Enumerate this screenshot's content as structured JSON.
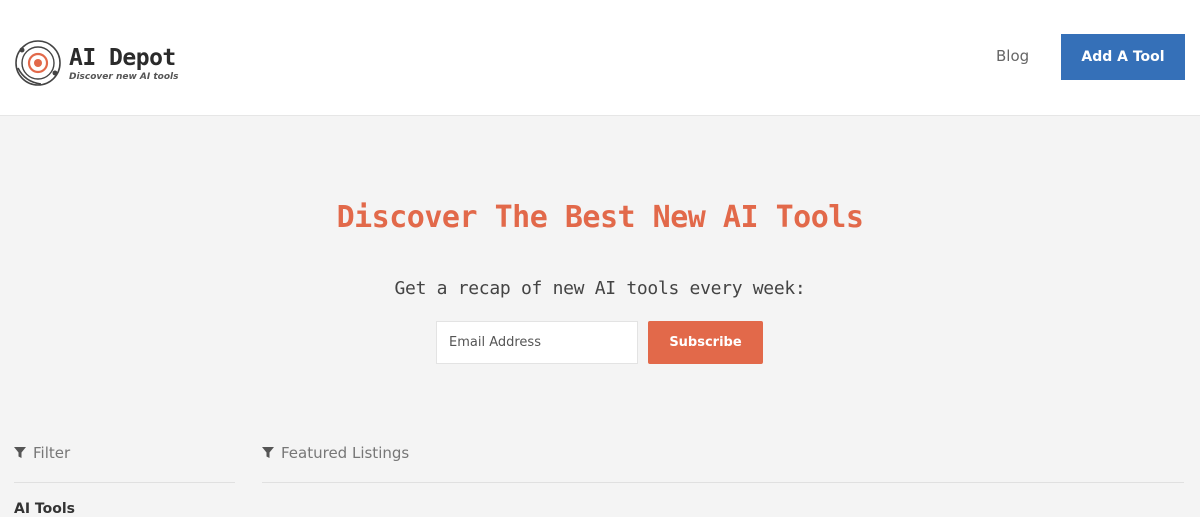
{
  "header": {
    "logo_title": "AI Depot",
    "logo_subtitle": "Discover new AI tools",
    "nav_blog": "Blog",
    "add_tool_label": "Add A Tool"
  },
  "hero": {
    "title": "Discover The Best New AI Tools",
    "subtitle": "Get a recap of new AI tools every week:",
    "email_placeholder": "Email Address",
    "subscribe_label": "Subscribe"
  },
  "sidebar": {
    "filter_label": "Filter",
    "category_heading": "AI Tools"
  },
  "main": {
    "featured_label": "Featured Listings"
  },
  "colors": {
    "accent": "#e2694a",
    "primary_button": "#3570b8",
    "background": "#f4f4f4"
  },
  "icons": {
    "logo": "orbit-logo-icon",
    "filter": "funnel-icon"
  }
}
